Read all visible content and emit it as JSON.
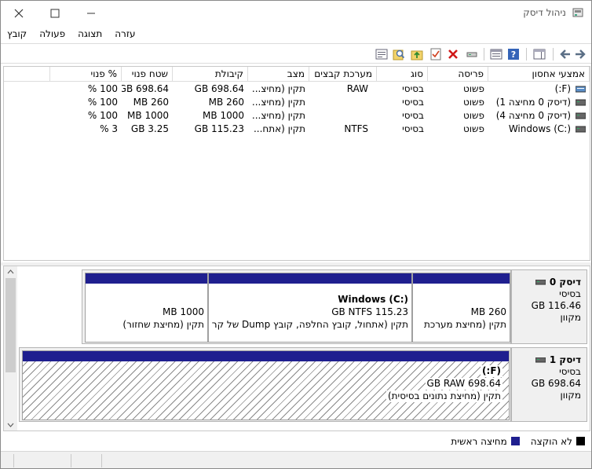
{
  "window": {
    "title": "ניהול דיסק"
  },
  "menu": [
    "קובץ",
    "פעולה",
    "תצוגה",
    "עזרה"
  ],
  "volume_table": {
    "columns": [
      "אמצעי אחסון",
      "פריסה",
      "סוג",
      "מערכת קבצים",
      "מצב",
      "קיבולת",
      "שטח פנוי",
      "% פנוי"
    ],
    "rows": [
      [
        "(F:)",
        "פשוט",
        "בסיסי",
        "RAW",
        "תקין (מחיצ...",
        "698.64 GB",
        "698.64 GB",
        "100 %"
      ],
      [
        "(דיסק 0 מחיצה 1)",
        "פשוט",
        "בסיסי",
        "",
        "תקין (מחיצ...",
        "260 MB",
        "260 MB",
        "100 %"
      ],
      [
        "(דיסק 0 מחיצה 4)",
        "פשוט",
        "בסיסי",
        "",
        "תקין (מחיצ...",
        "1000 MB",
        "1000 MB",
        "100 %"
      ],
      [
        "Windows (C:)",
        "פשוט",
        "בסיסי",
        "NTFS",
        "תקין (אתח...",
        "115.23 GB",
        "3.25 GB",
        "3 %"
      ]
    ]
  },
  "disks": [
    {
      "name": "דיסק 0",
      "type": "בסיסי",
      "size": "116.46 GB",
      "status": "מקוון",
      "partitions": [
        {
          "title": "",
          "size": "260 MB",
          "status": "תקין (מחיצת מערכת"
        },
        {
          "title": "Windows  (C:)",
          "size": "115.23 GB NTFS",
          "status": "תקין (אתחול, קובץ החלפה, קובץ Dump של קרי"
        },
        {
          "title": "",
          "size": "1000 MB",
          "status": "תקין (מחיצת שחזור)"
        }
      ]
    },
    {
      "name": "דיסק 1",
      "type": "בסיסי",
      "size": "698.64 GB",
      "status": "מקוון",
      "partitions": [
        {
          "title": "(F:)",
          "size": "698.64 GB RAW",
          "status": "תקין (מחיצת נתונים בסיסית)"
        }
      ]
    }
  ],
  "legend": [
    {
      "label": "לא הוקצה",
      "color": "#000000"
    },
    {
      "label": "מחיצה ראשית",
      "color": "#1f1f8f"
    }
  ],
  "icons": {
    "toolbar": [
      "back-arrow-icon",
      "forward-arrow-icon",
      "console-tree-icon",
      "help-icon",
      "properties-icon",
      "connect-drive-icon",
      "delete-icon",
      "checklist-icon",
      "up-folder-icon",
      "magnify-icon",
      "list-view-icon"
    ]
  }
}
